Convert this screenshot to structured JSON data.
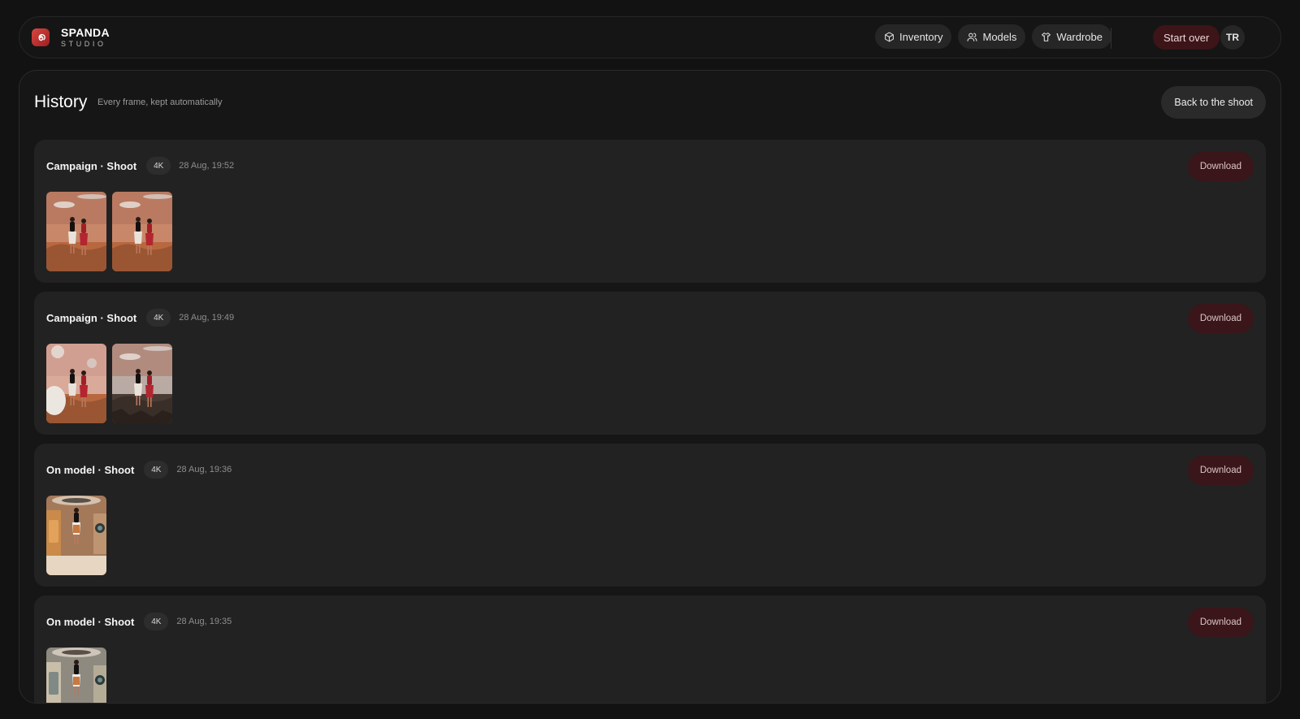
{
  "brand": {
    "name": "SPANDA",
    "sub": "STUDIO",
    "icon": "spiral-logo-icon"
  },
  "nav": [
    {
      "label": "Inventory",
      "icon": "box-icon"
    },
    {
      "label": "Models",
      "icon": "users-icon"
    },
    {
      "label": "Wardrobe",
      "icon": "shirt-icon"
    }
  ],
  "actions": {
    "start_over": "Start over",
    "avatar": "TR"
  },
  "page": {
    "title": "History",
    "subtitle": "Every frame, kept automatically",
    "back": "Back to the shoot"
  },
  "entries": [
    {
      "title": "Campaign · Shoot",
      "resolution": "4K",
      "time": "28 Aug, 19:52",
      "download": "Download",
      "thumbs": 2,
      "scene": "desert"
    },
    {
      "title": "Campaign · Shoot",
      "resolution": "4K",
      "time": "28 Aug, 19:49",
      "download": "Download",
      "thumbs": 2,
      "scene": "desert"
    },
    {
      "title": "On model · Shoot",
      "resolution": "4K",
      "time": "28 Aug, 19:36",
      "download": "Download",
      "thumbs": 1,
      "scene": "interior"
    },
    {
      "title": "On model · Shoot",
      "resolution": "4K",
      "time": "28 Aug, 19:35",
      "download": "Download",
      "thumbs": 1,
      "scene": "interior"
    }
  ],
  "colors": {
    "accent": "#3a151a",
    "logo": "#c8352f",
    "background": "#121212"
  }
}
